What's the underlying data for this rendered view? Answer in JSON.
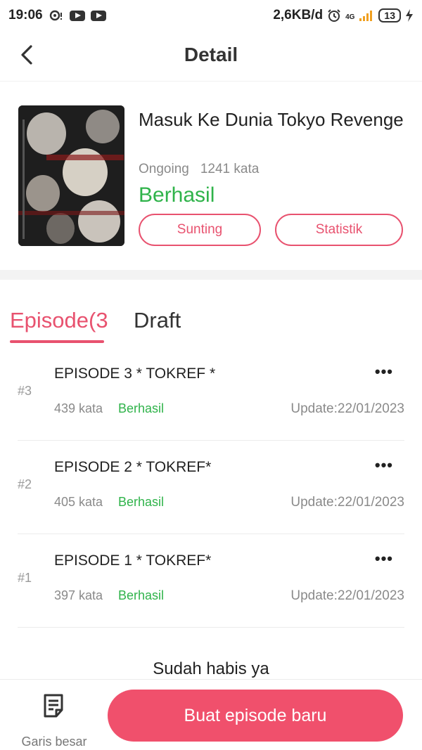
{
  "status_bar": {
    "time": "19:06",
    "speed": "2,6KB/d",
    "network": "4G",
    "battery": "13"
  },
  "header": {
    "title": "Detail"
  },
  "book": {
    "title": "Masuk Ke Dunia Tokyo Revenge",
    "state": "Ongoing",
    "word_count": "1241 kata",
    "status": "Berhasil",
    "edit_label": "Sunting",
    "stats_label": "Statistik"
  },
  "tabs": {
    "episodes_label": "Episode(3",
    "draft_label": "Draft"
  },
  "episodes": [
    {
      "num": "#3",
      "title": "EPISODE 3 * TOKREF *",
      "words": "439 kata",
      "status": "Berhasil",
      "update": "Update:22/01/2023"
    },
    {
      "num": "#2",
      "title": "EPISODE 2 * TOKREF*",
      "words": "405 kata",
      "status": "Berhasil",
      "update": "Update:22/01/2023"
    },
    {
      "num": "#1",
      "title": "EPISODE 1 * TOKREF*",
      "words": "397 kata",
      "status": "Berhasil",
      "update": "Update:22/01/2023"
    }
  ],
  "end_text": "Sudah habis ya",
  "bottom": {
    "outline_label": "Garis besar",
    "create_label": "Buat episode baru"
  },
  "colors": {
    "accent": "#e8526f",
    "success": "#2fb34a",
    "primary_button": "#f0506c"
  }
}
